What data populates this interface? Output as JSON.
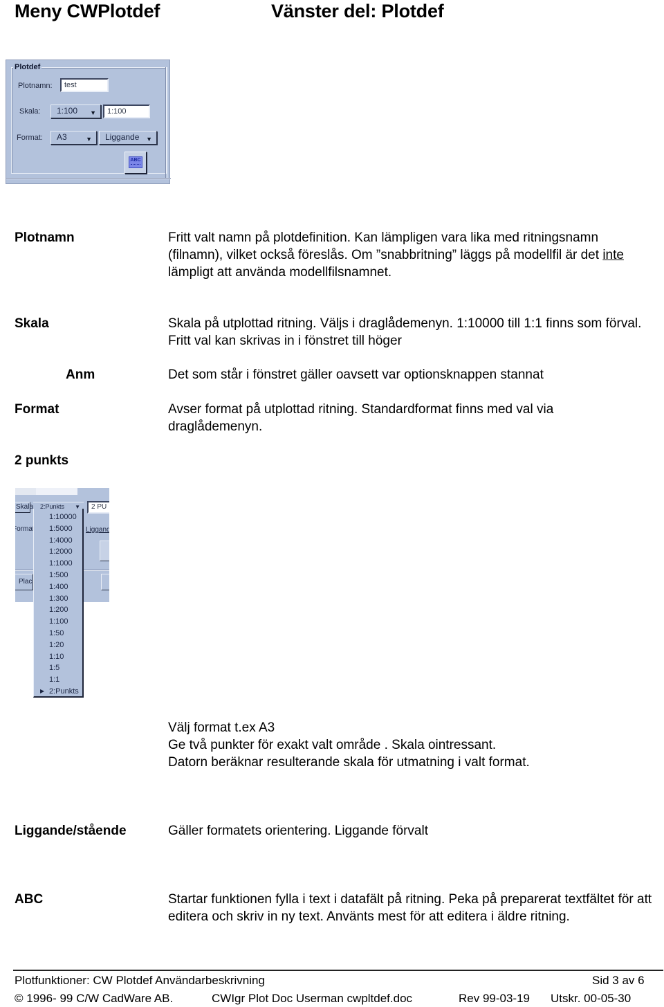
{
  "header": {
    "title_left": "Meny CWPlotdef",
    "title_right": "Vänster del: Plotdef"
  },
  "screenshot_plotdef": {
    "group_label": "Plotdef",
    "plotnamn_label": "Plotnamn:",
    "plotnamn_value": "test",
    "skala_label": "Skala:",
    "skala_selected": "1:100",
    "skala_custom_value": "1:100",
    "format_label": "Format:",
    "format_selected": "A3",
    "orientation_selected": "Liggande",
    "abc_button_label": "ABC",
    "dropdown_arrow_icon": "▼",
    "colors": {
      "panel_bg": "#b3c2dc",
      "abc_icon": "#7b86e8"
    }
  },
  "sections": [
    {
      "term": "Plotnamn",
      "lines_before_underline": "Fritt valt namn på plotdefinition. Kan lämpligen vara lika med ritningsnamn (filnamn), vilket också föreslås. Om ”snabbritning” läggs på modellfil är det ",
      "underlined": "inte",
      "lines_after_underline": " lämpligt att använda modellfilsnamnet."
    },
    {
      "term": "Skala",
      "description": "Skala på utplottad ritning. Väljs i draglådemenyn. 1:10000 till 1:1 finns som förval. Fritt val kan skrivas in i fönstret till höger"
    },
    {
      "term": "Anm",
      "description": "Det som står i fönstret gäller oavsett var optionsknappen stannat"
    },
    {
      "term": "Format",
      "description": "Avser format på utplottad ritning. Standardformat finns med val via draglådemenyn."
    },
    {
      "term": "2 punkts",
      "description_lines": [
        "Välj format t.ex A3",
        "Ge två punkter för exakt valt område . Skala ointressant.",
        "Datorn beräknar resulterande skala för utmatning i valt format."
      ]
    },
    {
      "term": "Liggande/stående",
      "description": "Gäller formatets orientering. Liggande förvalt"
    },
    {
      "term": "ABC",
      "description": "Startar funktionen fylla i text i datafält på ritning. Peka på preparerat textfältet för att editera och skriv in ny text. Använts mest för att editera i äldre ritning."
    }
  ],
  "screenshot_dropdown": {
    "left_label_skala": "Skala",
    "left_label_format": "Format",
    "left_label_plac": "Plac",
    "combo_value": "2:Punkts",
    "right_field_value": "2 PU",
    "right_combo_value": "Liggande",
    "options": [
      "1:10000",
      "1:5000",
      "1:4000",
      "1:2000",
      "1:1000",
      "1:500",
      "1:400",
      "1:300",
      "1:200",
      "1:100",
      "1:50",
      "1:20",
      "1:10",
      "1:5",
      "1:1",
      "2:Punkts"
    ],
    "selected_pointer_icon": "▶"
  },
  "footer": {
    "doc_title": "Plotfunktioner: CW Plotdef Användarbeskrivning",
    "page": "Sid 3 av 6",
    "copyright": "© 1996- 99 C/W CadWare AB.",
    "doc_file": "CWIgr Plot Doc Userman cwpltdef.doc",
    "revision": "Rev 99-03-19",
    "printed": "Utskr. 00-05-30"
  }
}
